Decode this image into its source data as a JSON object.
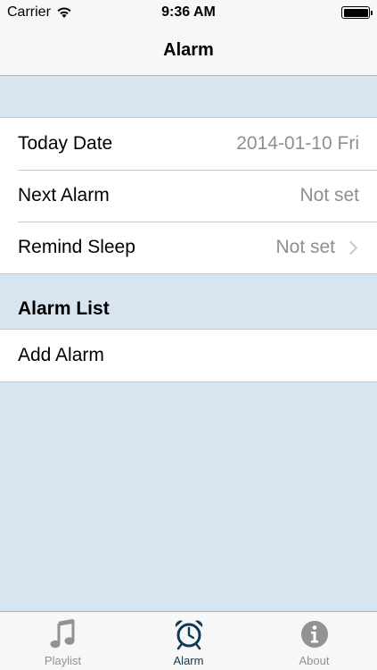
{
  "status_bar": {
    "carrier": "Carrier",
    "time": "9:36 AM"
  },
  "nav": {
    "title": "Alarm"
  },
  "info_rows": [
    {
      "label": "Today Date",
      "value": "2014-01-10 Fri"
    },
    {
      "label": "Next Alarm",
      "value": "Not set"
    },
    {
      "label": "Remind Sleep",
      "value": "Not set"
    }
  ],
  "alarm_list": {
    "header": "Alarm List",
    "add_label": "Add Alarm"
  },
  "tabs": [
    {
      "label": "Playlist",
      "icon": "music-note-icon",
      "active": false
    },
    {
      "label": "Alarm",
      "icon": "alarm-clock-icon",
      "active": true
    },
    {
      "label": "About",
      "icon": "info-icon",
      "active": false
    }
  ],
  "colors": {
    "background": "#d7e5f1",
    "active_tab": "#0e3a53",
    "inactive_tab": "#929292",
    "secondary_text": "#8e8e93"
  }
}
